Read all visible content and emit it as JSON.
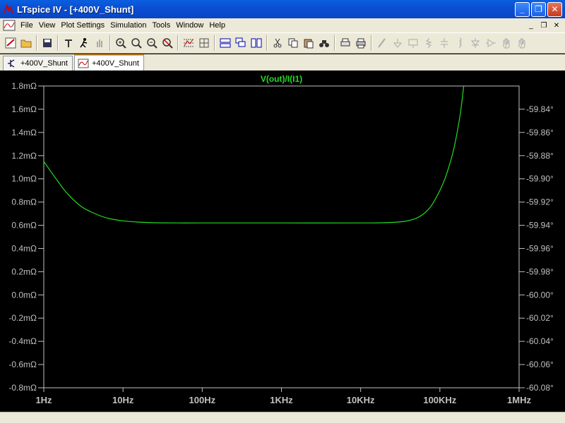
{
  "window": {
    "title": "LTspice IV - [+400V_Shunt]",
    "minimize": "_",
    "maximize": "❐",
    "close": "✕"
  },
  "menu": {
    "items": [
      "File",
      "View",
      "Plot Settings",
      "Simulation",
      "Tools",
      "Window",
      "Help"
    ],
    "mdi_minimize": "_",
    "mdi_restore": "❐",
    "mdi_close": "✕"
  },
  "toolbar": {
    "icons": [
      "run-icon",
      "open-icon",
      "save-icon",
      "control-panel-icon",
      "run-sim-icon",
      "halt-icon",
      "zoom-in-icon",
      "zoom-box-icon",
      "zoom-out-icon",
      "zoom-fit-icon",
      "autorange-icon",
      "grid-icon",
      "tile-horizontal-icon",
      "cascade-icon",
      "tile-vertical-icon",
      "cut-icon",
      "copy-icon",
      "paste-icon",
      "find-icon",
      "print-preview-icon",
      "print-icon",
      "wire-icon",
      "ground-icon",
      "label-icon",
      "resistor-icon",
      "capacitor-icon",
      "inductor-icon",
      "diode-icon",
      "component-icon",
      "move-icon",
      "drag-icon"
    ]
  },
  "tabs": [
    {
      "label": "+400V_Shunt",
      "icon": "schematic-icon",
      "active": false
    },
    {
      "label": "+400V_Shunt",
      "icon": "waveform-icon",
      "active": true
    }
  ],
  "colors": {
    "trace": "#22dd22",
    "axis_text": "#c0c0c0",
    "frame": "#c0c0c0",
    "background": "#000000"
  },
  "chart_data": {
    "type": "line",
    "title": "V(out)/I(I1)",
    "x_scale": "log",
    "xlim": [
      1,
      1000000
    ],
    "x_ticks": [
      {
        "value": 1,
        "label": "1Hz"
      },
      {
        "value": 10,
        "label": "10Hz"
      },
      {
        "value": 100,
        "label": "100Hz"
      },
      {
        "value": 1000,
        "label": "1KHz"
      },
      {
        "value": 10000,
        "label": "10KHz"
      },
      {
        "value": 100000,
        "label": "100KHz"
      },
      {
        "value": 1000000,
        "label": "1MHz"
      }
    ],
    "ylim": [
      -0.8,
      1.8
    ],
    "y_ticks": [
      {
        "value": 1.8,
        "label": "1.8mΩ"
      },
      {
        "value": 1.6,
        "label": "1.6mΩ"
      },
      {
        "value": 1.4,
        "label": "1.4mΩ"
      },
      {
        "value": 1.2,
        "label": "1.2mΩ"
      },
      {
        "value": 1.0,
        "label": "1.0mΩ"
      },
      {
        "value": 0.8,
        "label": "0.8mΩ"
      },
      {
        "value": 0.6,
        "label": "0.6mΩ"
      },
      {
        "value": 0.4,
        "label": "0.4mΩ"
      },
      {
        "value": 0.2,
        "label": "0.2mΩ"
      },
      {
        "value": 0.0,
        "label": "0.0mΩ"
      },
      {
        "value": -0.2,
        "label": "-0.2mΩ"
      },
      {
        "value": -0.4,
        "label": "-0.4mΩ"
      },
      {
        "value": -0.6,
        "label": "-0.6mΩ"
      },
      {
        "value": -0.8,
        "label": "-0.8mΩ"
      }
    ],
    "y2_ticks": [
      {
        "label": "-59.84°"
      },
      {
        "label": "-59.86°"
      },
      {
        "label": "-59.88°"
      },
      {
        "label": "-59.90°"
      },
      {
        "label": "-59.92°"
      },
      {
        "label": "-59.94°"
      },
      {
        "label": "-59.96°"
      },
      {
        "label": "-59.98°"
      },
      {
        "label": "-60.00°"
      },
      {
        "label": "-60.02°"
      },
      {
        "label": "-60.04°"
      },
      {
        "label": "-60.06°"
      },
      {
        "label": "-60.08°"
      }
    ],
    "y2_values": [
      -59.84,
      -59.86,
      -59.88,
      -59.9,
      -59.92,
      -59.94,
      -59.96,
      -59.98,
      -60.0,
      -60.02,
      -60.04,
      -60.06,
      -60.08
    ],
    "series": [
      {
        "name": "V(out)/I(I1)",
        "x": [
          1,
          1.5,
          2,
          3,
          5,
          7,
          10,
          15,
          20,
          30,
          50,
          100,
          1000,
          10000,
          20000,
          30000,
          40000,
          50000,
          60000,
          70000,
          80000,
          100000,
          120000,
          150000,
          180000,
          200000
        ],
        "y": [
          1.15,
          0.98,
          0.87,
          0.76,
          0.685,
          0.655,
          0.638,
          0.628,
          0.624,
          0.621,
          0.62,
          0.62,
          0.62,
          0.62,
          0.622,
          0.628,
          0.64,
          0.66,
          0.69,
          0.73,
          0.78,
          0.9,
          1.03,
          1.26,
          1.55,
          1.8
        ]
      }
    ]
  }
}
